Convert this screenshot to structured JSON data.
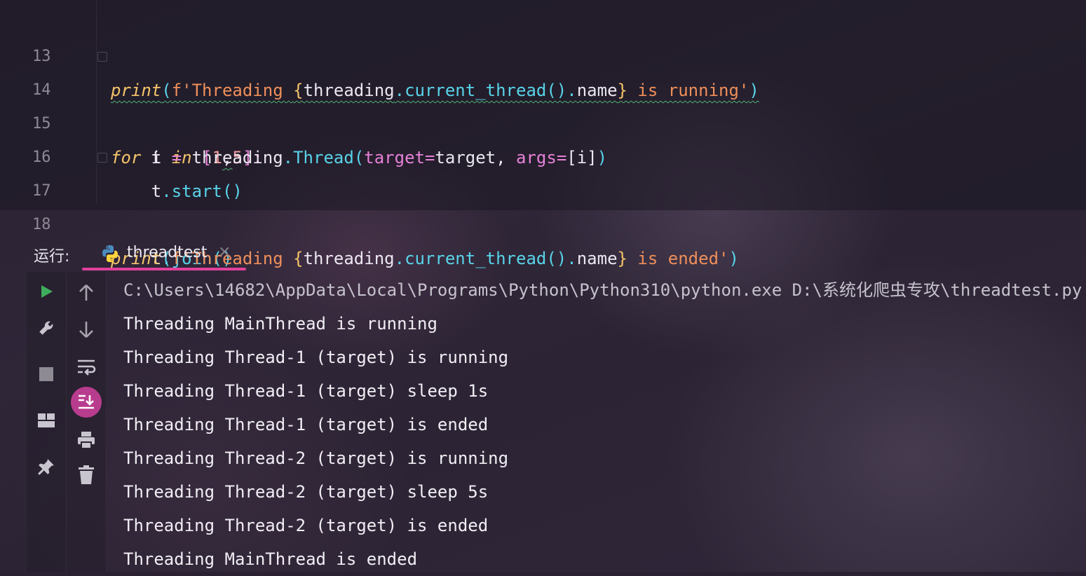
{
  "editor": {
    "lines": [
      {
        "num": "13"
      },
      {
        "num": "14"
      },
      {
        "num": "15"
      },
      {
        "num": "16"
      },
      {
        "num": "17"
      },
      {
        "num": "18"
      }
    ],
    "tokens": {
      "print": "print",
      "f_prefix": "f'",
      "threading_word": "Threading ",
      "lbrace": "{",
      "rbrace": "}",
      "threading_mod": "threading",
      "dot": ".",
      "current_thread": "current_thread",
      "parens": "()",
      "name_attr": "name",
      "is_running": " is running'",
      "is_ended": " is ended'",
      "lparen": "(",
      "rparen": ")",
      "for_kw": "for",
      "i_var": " i ",
      "in_kw": "in",
      "list_open": " [",
      "num1": "1",
      "comma": ",",
      "num5": "5",
      "list_close": "]:",
      "t_assign": "t ",
      "eq": "=",
      "threading_sp": " threading",
      "Thread": "Thread",
      "target_kw": "target",
      "target_val": "target, ",
      "args_kw": "args",
      "args_val": "[i]",
      "indent": "    ",
      "t_var": "t",
      "start": "start",
      "join": "join"
    }
  },
  "run_panel": {
    "label": "运行:",
    "tab_label": "threadtest",
    "close_glyph": "×",
    "accent_color": "#e0409a"
  },
  "toolbar": {
    "left_icons": [
      "run-icon",
      "wrench-icon",
      "stop-icon",
      "layout-icon",
      "pin-icon"
    ],
    "right_icons": [
      "arrow-up-icon",
      "arrow-down-icon",
      "soft-wrap-icon",
      "scroll-to-end-icon",
      "print-icon",
      "trash-icon"
    ]
  },
  "console": {
    "lines": [
      "C:\\Users\\14682\\AppData\\Local\\Programs\\Python\\Python310\\python.exe D:\\系统化爬虫专攻\\threadtest.py",
      "Threading MainThread is running",
      "Threading Thread-1 (target) is running",
      "Threading Thread-1 (target) sleep 1s",
      "Threading Thread-1 (target) is ended",
      "Threading Thread-2 (target) is running",
      "Threading Thread-2 (target) sleep 5s",
      "Threading Thread-2 (target) is ended",
      "Threading MainThread is ended"
    ]
  }
}
